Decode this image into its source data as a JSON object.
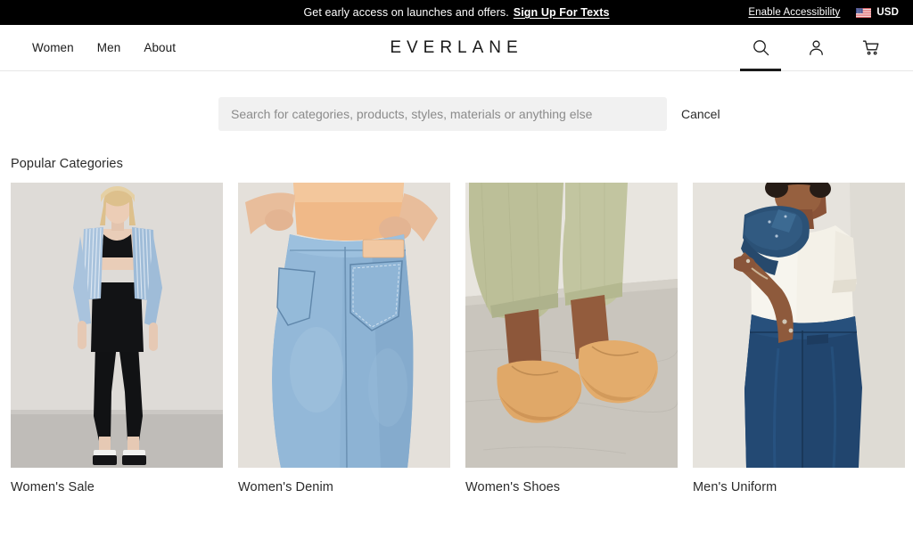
{
  "promo": {
    "message": "Get early access on launches and offers.",
    "signup_link": "Sign Up For Texts",
    "accessibility_link": "Enable Accessibility",
    "currency": "USD",
    "flag_icon": "us-flag-icon",
    "background": "#000000"
  },
  "nav": {
    "links": [
      {
        "label": "Women"
      },
      {
        "label": "Men"
      },
      {
        "label": "About"
      }
    ],
    "brand": "EVERLANE",
    "icons": [
      {
        "name": "search-icon",
        "active": true
      },
      {
        "name": "account-icon",
        "active": false
      },
      {
        "name": "cart-icon",
        "active": false
      }
    ]
  },
  "search": {
    "placeholder": "Search for categories, products, styles, materials or anything else",
    "value": "",
    "cancel_label": "Cancel"
  },
  "main": {
    "section_title": "Popular Categories",
    "categories": [
      {
        "label": "Women's Sale",
        "image_alt": "Model in blue striped shirt, black bra top and black capri leggings with white platform sandals"
      },
      {
        "label": "Women's Denim",
        "image_alt": "Close-up back view of light blue high-rise denim jeans with peach top"
      },
      {
        "label": "Women's Shoes",
        "image_alt": "Tan leather ballet flats worn with sage green cropped pants on concrete floor"
      },
      {
        "label": "Men's Uniform",
        "image_alt": "Model in white t-shirt and navy trousers with navy shirt over shoulder"
      }
    ]
  },
  "colors": {
    "banner_bg": "#000000",
    "text": "#2b2b2b",
    "search_bg": "#f1f1f1",
    "border": "#e6e6e6"
  }
}
